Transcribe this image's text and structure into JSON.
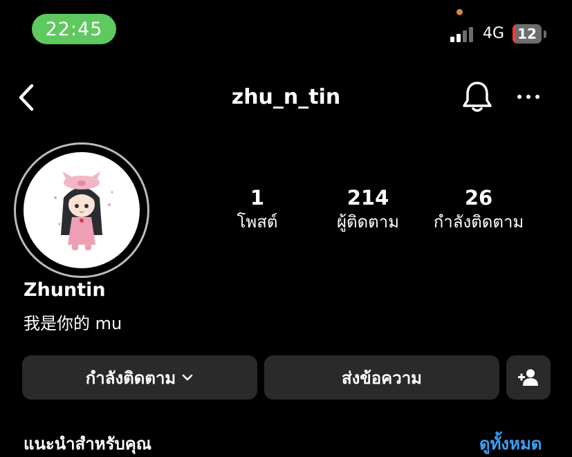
{
  "status_bar": {
    "time": "22:45",
    "network": "4G",
    "battery": "12",
    "battery_color": "#ff3b30",
    "pill_color": "#5ec95e"
  },
  "header": {
    "username": "zhu_n_tin",
    "back_icon": "chevron-left-icon",
    "bell_icon": "bell-icon",
    "more_icon": "more-horizontal-icon"
  },
  "profile": {
    "display_name": "Zhuntin",
    "bio": "我是你的 mu",
    "stats": [
      {
        "value": "1",
        "label": "โพสต์"
      },
      {
        "value": "214",
        "label": "ผู้ติดตาม"
      },
      {
        "value": "26",
        "label": "กำลังติดตาม"
      }
    ]
  },
  "actions": {
    "following_label": "กำลังติดตาม",
    "message_label": "ส่งข้อความ",
    "add_user_icon": "add-user-icon"
  },
  "suggestions": {
    "title": "แนะนำสำหรับคุณ",
    "see_all": "ดูทั้งหมด",
    "link_color": "#3aa0f3"
  }
}
